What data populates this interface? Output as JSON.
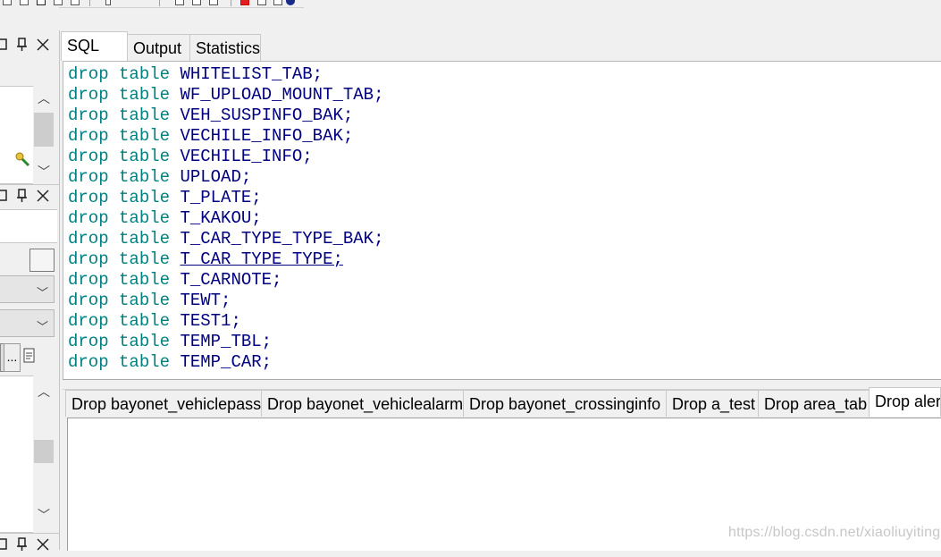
{
  "editor": {
    "tabs": [
      "SQL",
      "Output",
      "Statistics"
    ],
    "keyword": "drop",
    "keyword2": "table",
    "lines": [
      "WHITELIST_TAB;",
      "WF_UPLOAD_MOUNT_TAB;",
      "VEH_SUSPINFO_BAK;",
      "VECHILE_INFO_BAK;",
      "VECHILE_INFO;",
      "UPLOAD;",
      "T_PLATE;",
      "T_KAKOU;",
      "T_CAR_TYPE_TYPE_BAK;",
      "T_CAR_TYPE_TYPE;",
      "T_CARNOTE;",
      "TEWT;",
      "TEST1;",
      "TEMP_TBL;",
      "TEMP_CAR;"
    ]
  },
  "results": {
    "tabs": [
      "Drop bayonet_vehiclepass",
      "Drop bayonet_vehiclealarm",
      "Drop bayonet_crossinginfo",
      "Drop a_test",
      "Drop area_tab",
      "Drop aler"
    ]
  },
  "left_panel": {
    "browse_button": "..."
  },
  "watermark": "https://blog.csdn.net/xiaoliuyiting",
  "icons": [
    "arrow-right-blue-icon",
    "arrow-right-red-icon",
    "minimize-icon",
    "pin-icon",
    "close-icon",
    "key-icon",
    "chevron-up-icon",
    "chevron-down-icon",
    "document-icon"
  ],
  "colors": {
    "keyword": "#008080",
    "identifier": "#000080",
    "background": "#f0f0f0"
  }
}
